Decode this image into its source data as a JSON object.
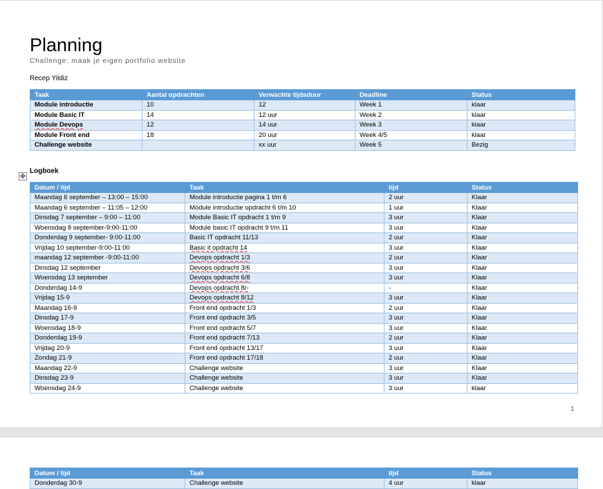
{
  "document": {
    "title": "Planning",
    "subtitle": "Challenge: maak je eigen portfolio website",
    "author": "Recep Yildiz",
    "page_number": "1"
  },
  "planning": {
    "headers": [
      "Taak",
      "Aantal opdrachten",
      "Verwachte tijdsduur",
      "Deadline",
      "Status"
    ],
    "rows": [
      [
        "Module introductie",
        "10",
        "12",
        "Week 1",
        "klaar"
      ],
      [
        "Module Basic IT",
        "14",
        "12 uur",
        "Week 2",
        "klaar"
      ],
      [
        "Module Devops",
        "12",
        "14 uur",
        "Week 3",
        "klaar"
      ],
      [
        "Module Front end",
        "18",
        "20 uur",
        "Week 4/5",
        "klaar"
      ],
      [
        "Challenge website",
        "",
        "xx uur",
        "Week 5",
        "Bezig"
      ]
    ]
  },
  "logbook": {
    "heading": "Logboek",
    "move_handle": "✥",
    "headers": [
      "Datum / tijd",
      "Taak",
      "tijd",
      "Status"
    ],
    "rows": [
      [
        "Maandag 6 september – 13:00 – 15:00",
        "Module introductie pagina 1 t/m 6",
        "2 uur",
        "Klaar"
      ],
      [
        "Maandag 6 september – 11:05 – 12:00",
        "Module introductie opdracht 6 t/m 10",
        "1 uur",
        "Klaar"
      ],
      [
        "Dinsdag 7 september – 9:00 – 11:00",
        "Module Basic IT opdracht 1 t/m 9",
        "3 uur",
        "Klaar"
      ],
      [
        "Woensdag 8 september-9:00-11:00",
        "Module basic IT opdracht 9 t/m 11",
        "3 uur",
        "Klaar"
      ],
      [
        "Donderdag 9 september- 9:00-11:00",
        "Basic IT opdracht 11/13",
        "2 uur",
        "Klaar"
      ],
      [
        "Vrijdag 10 september-9:00-11:00",
        "Basic it opdracht 14",
        "3 uur",
        "Klaar"
      ],
      [
        "maandag 12 september -9:00-11:00",
        "Devops opdracht 1/3",
        "2 uur",
        "Klaar"
      ],
      [
        "Dinsdag 12 september",
        "Devops opdracht 3/6",
        "3 uur",
        "Klaar"
      ],
      [
        "Woensdag 13 september",
        "Devops opdracht 6/8",
        "3 uur",
        "Klaar"
      ],
      [
        "Donderdag 14-9",
        "Devops opdracht 8/-",
        "-",
        "Klaar"
      ],
      [
        "Vrijdag 15-9",
        "Devops opdracht 8/12",
        "3 uur",
        "Klaar"
      ],
      [
        "Maandag 16-9",
        "Front end opdracht 1/3",
        "2 uur",
        "Klaar"
      ],
      [
        "Dinsdag 17-9",
        "Front end opdracht 3/5",
        "3 uur",
        "Klaar"
      ],
      [
        "Woensdag 18-9",
        "Front end opdracht 5/7",
        "3 uur",
        "Klaar"
      ],
      [
        "Donderdag 19-9",
        "Front end opdracht 7/13",
        "2 uur",
        "Klaar"
      ],
      [
        "Vrijdag 20-9",
        "Front end opdracht 13/17",
        "3 uur",
        "Klaar"
      ],
      [
        "Zondag 21-9",
        "Front end opdracht 17/18",
        "2 uur",
        "Klaar"
      ],
      [
        "Maandag 22-9",
        "Challenge website",
        "3 uur",
        "Klaar"
      ],
      [
        "Dinsdag 23-9",
        "Challenge website",
        "3 uur",
        "Klaar"
      ],
      [
        "Woensdag 24-9",
        "Challenge website",
        "3 uur",
        "klaar"
      ]
    ]
  },
  "logbook_continued": {
    "headers": [
      "Datum / tijd",
      "Taak",
      "tijd",
      "Status"
    ],
    "rows": [
      [
        "Donderdag 30-9",
        "Challenge website",
        "4 uur",
        "klaar"
      ]
    ]
  },
  "colors": {
    "header_fill": "#5b9bd5",
    "band_fill": "#dde9f6",
    "border": "#9dc3e6"
  }
}
